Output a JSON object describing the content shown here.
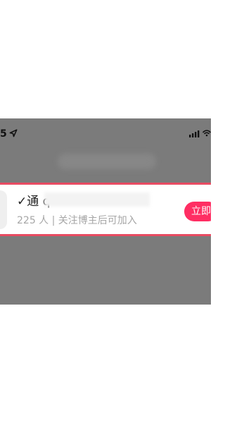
{
  "status_bar": {
    "time": "5"
  },
  "group_card": {
    "name": "✓通 q",
    "meta": "225 人  |  关注博主后可加入",
    "join_label": "立即"
  },
  "colors": {
    "accent": "#ff2e63",
    "highlight_border": "#e84b62",
    "dim_overlay": "#7b7b7b"
  }
}
